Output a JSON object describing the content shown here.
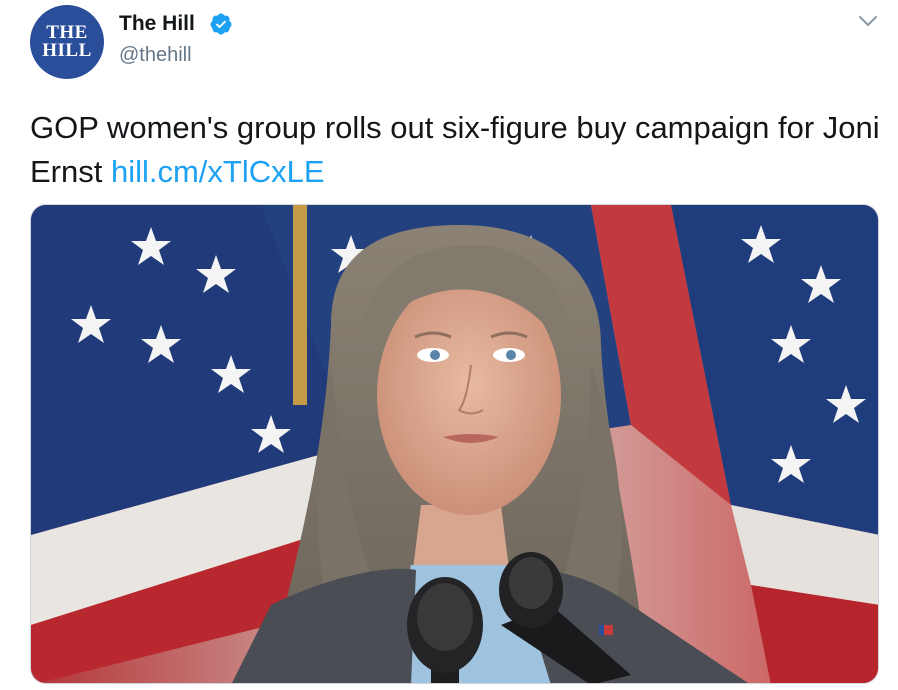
{
  "author": {
    "display_name": "The Hill",
    "handle": "@thehill",
    "avatar_text": [
      "THE",
      "HILL"
    ],
    "verified": true
  },
  "tweet": {
    "text": "GOP women's group rolls out six-figure buy campaign for Joni Ernst",
    "link": "hill.cm/xTlCxLE"
  },
  "icons": {
    "verified": "verified-badge-icon",
    "menu": "chevron-down-icon"
  },
  "colors": {
    "link": "#1da1f2",
    "verified": "#1da1f2",
    "avatar_bg": "#2b4e9b",
    "handle": "#657786"
  },
  "media": {
    "alt_subject": "photo"
  }
}
